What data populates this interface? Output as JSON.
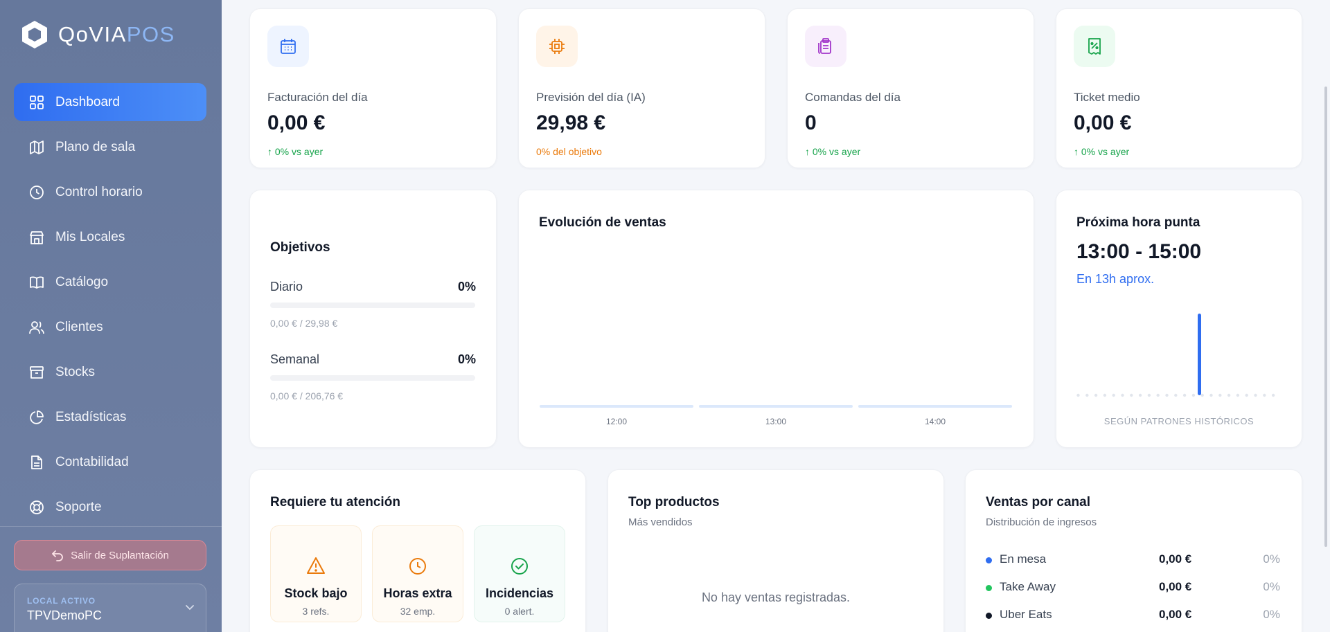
{
  "brand": {
    "name_main": "QoVIA",
    "name_accent": "POS"
  },
  "sidebar": {
    "items": [
      {
        "label": "Dashboard",
        "icon": "grid-icon",
        "active": true
      },
      {
        "label": "Plano de sala",
        "icon": "map-icon"
      },
      {
        "label": "Control horario",
        "icon": "clock-icon"
      },
      {
        "label": "Mis Locales",
        "icon": "store-icon"
      },
      {
        "label": "Catálogo",
        "icon": "book-icon"
      },
      {
        "label": "Clientes",
        "icon": "users-icon"
      },
      {
        "label": "Stocks",
        "icon": "archive-icon"
      },
      {
        "label": "Estadísticas",
        "icon": "pie-chart-icon"
      },
      {
        "label": "Contabilidad",
        "icon": "document-icon"
      },
      {
        "label": "Soporte",
        "icon": "lifebuoy-icon"
      }
    ],
    "exit_label": "Salir de Suplantación",
    "local_label": "LOCAL ACTIVO",
    "local_name": "TPVDemoPC"
  },
  "kpis": [
    {
      "label": "Facturación del día",
      "value": "0,00 €",
      "delta": "↑ 0% vs ayer",
      "icon": "calendar-icon",
      "tone": "green",
      "icon_bg": "#eef4ff",
      "icon_color": "#2f6df0"
    },
    {
      "label": "Previsión del día (IA)",
      "value": "29,98 €",
      "delta": "0% del objetivo",
      "icon": "cpu-icon",
      "tone": "orange",
      "icon_bg": "#fff4e8",
      "icon_color": "#ea7a0b"
    },
    {
      "label": "Comandas del día",
      "value": "0",
      "delta": "↑ 0% vs ayer",
      "icon": "clipboard-icon",
      "tone": "green",
      "icon_bg": "#f8effc",
      "icon_color": "#a235c9"
    },
    {
      "label": "Ticket medio",
      "value": "0,00 €",
      "delta": "↑ 0% vs ayer",
      "icon": "receipt-icon",
      "tone": "green",
      "icon_bg": "#ecfbf1",
      "icon_color": "#16a34a"
    }
  ],
  "objetivos": {
    "title": "Objetivos",
    "rows": [
      {
        "label": "Diario",
        "pct": "0%",
        "progress": 0,
        "sub": "0,00 € / 29,98 €"
      },
      {
        "label": "Semanal",
        "pct": "0%",
        "progress": 0,
        "sub": "0,00 € / 206,76 €"
      }
    ]
  },
  "ventas": {
    "title": "Evolución de ventas",
    "ticks": [
      "12:00",
      "13:00",
      "14:00"
    ]
  },
  "peak": {
    "title": "Próxima hora punta",
    "time": "13:00 - 15:00",
    "sub": "En 13h aprox.",
    "foot": "SEGÚN PATRONES HISTÓRICOS",
    "accent": "#2f6df0"
  },
  "attention": {
    "title": "Requiere tu atención",
    "tiles": [
      {
        "title": "Stock bajo",
        "sub": "3 refs.",
        "icon": "warning-icon",
        "color": "#ea7a0b",
        "bg": "#fffbf5",
        "border": "#fbecd7"
      },
      {
        "title": "Horas extra",
        "sub": "32 emp.",
        "icon": "clock-icon",
        "color": "#ea7a0b",
        "bg": "#fffbf5",
        "border": "#fbecd7"
      },
      {
        "title": "Incidencias",
        "sub": "0 alert.",
        "icon": "check-circle-icon",
        "color": "#16a34a",
        "bg": "#f6fcfa",
        "border": "#e2f3ec"
      }
    ]
  },
  "top": {
    "title": "Top productos",
    "subtitle": "Más vendidos",
    "empty": "No hay ventas registradas."
  },
  "canal": {
    "title": "Ventas por canal",
    "subtitle": "Distribución de ingresos",
    "rows": [
      {
        "name": "En mesa",
        "value": "0,00 €",
        "pct": "0%",
        "color": "#2f6df0"
      },
      {
        "name": "Take Away",
        "value": "0,00 €",
        "pct": "0%",
        "color": "#22c55e"
      },
      {
        "name": "Uber Eats",
        "value": "0,00 €",
        "pct": "0%",
        "color": "#111827"
      }
    ]
  }
}
